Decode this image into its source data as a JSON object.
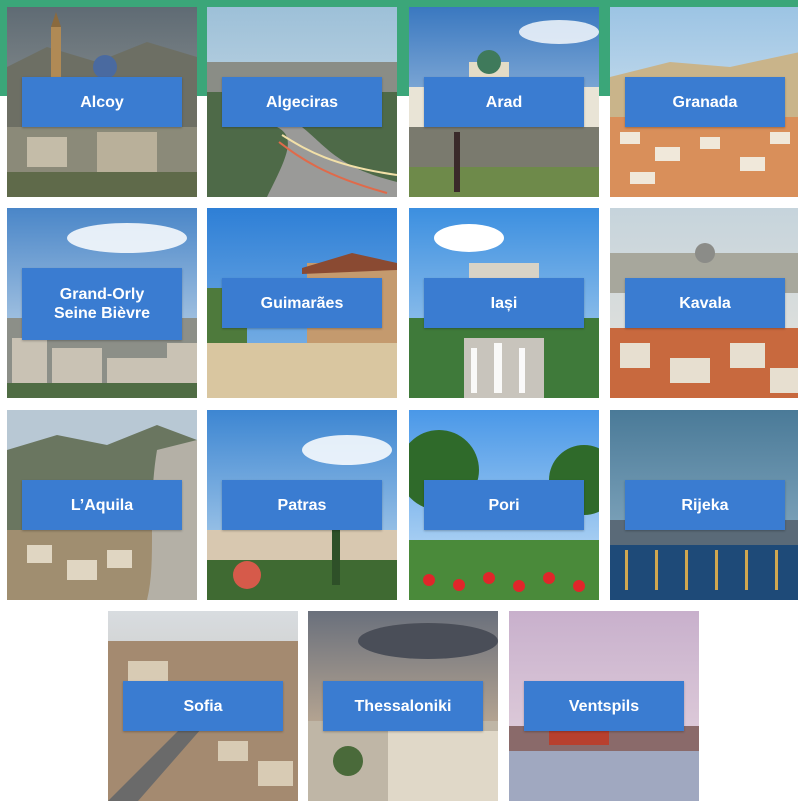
{
  "cities": [
    {
      "name": "Alcoy",
      "scene": "town"
    },
    {
      "name": "Algeciras",
      "scene": "highway"
    },
    {
      "name": "Arad",
      "scene": "square"
    },
    {
      "name": "Granada",
      "scene": "hill-town"
    },
    {
      "name_line1": "Grand-Orly",
      "name_line2": "Seine Bièvre",
      "scene": "suburb"
    },
    {
      "name": "Guimarães",
      "scene": "plaza"
    },
    {
      "name": "Iași",
      "scene": "fountain"
    },
    {
      "name": "Kavala",
      "scene": "rooftops"
    },
    {
      "name": "L’Aquila",
      "scene": "mountain"
    },
    {
      "name": "Patras",
      "scene": "coast"
    },
    {
      "name": "Pori",
      "scene": "park"
    },
    {
      "name": "Rijeka",
      "scene": "night-harbor"
    },
    {
      "name": "Sofia",
      "scene": "aerial-city"
    },
    {
      "name": "Thessaloniki",
      "scene": "waterfront"
    },
    {
      "name": "Ventspils",
      "scene": "harbor"
    }
  ],
  "colors": {
    "band": "#3ba679",
    "label_bg": "#3a7cd1",
    "label_text": "#ffffff"
  }
}
